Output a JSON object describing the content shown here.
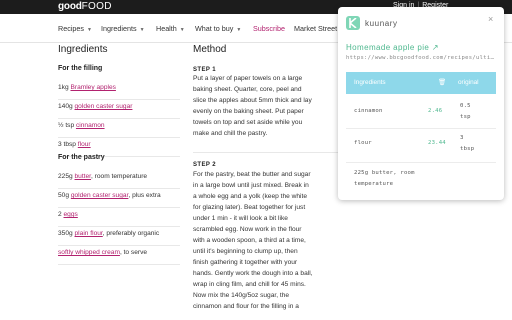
{
  "site": {
    "logo_bold": "good",
    "logo_light": "FOOD",
    "auth": {
      "sign_in": "Sign in",
      "separator": "|",
      "register": "Register"
    }
  },
  "nav": {
    "items": [
      {
        "label": "Recipes",
        "caret": "▼"
      },
      {
        "label": "Ingredients",
        "caret": "▼"
      },
      {
        "label": "Health",
        "caret": "▼"
      },
      {
        "label": "What to buy",
        "caret": "▼"
      },
      {
        "label": "Subscribe",
        "caret": ""
      },
      {
        "label": "Market Street",
        "caret": ""
      }
    ]
  },
  "ingredients": {
    "title": "Ingredients",
    "filling_heading": "For the filling",
    "filling": [
      {
        "qty": "1kg ",
        "link": "Bramley apples",
        "rest": ""
      },
      {
        "qty": "140g ",
        "link": "golden caster sugar",
        "rest": ""
      },
      {
        "qty": "½ tsp ",
        "link": "cinnamon",
        "rest": ""
      },
      {
        "qty": "3 tbsp ",
        "link": "flour",
        "rest": ""
      }
    ],
    "pastry_heading": "For the pastry",
    "pastry": [
      {
        "qty": "225g ",
        "link": "butter",
        "rest": ", room temperature"
      },
      {
        "qty": "50g ",
        "link": "golden caster sugar",
        "rest": ", plus extra"
      },
      {
        "qty": "2 ",
        "link": "eggs",
        "rest": ""
      },
      {
        "qty": "350g ",
        "link": "plain flour",
        "rest": ", preferably organic"
      },
      {
        "qty": "",
        "link": "softly whipped cream",
        "rest": ", to serve"
      }
    ]
  },
  "method": {
    "title": "Method",
    "step1_label": "STEP 1",
    "step1_lines": [
      "Put a layer of paper towels on a large",
      "baking sheet. Quarter, core, peel and",
      "slice the apples about 5mm thick and lay",
      "evenly on the baking sheet. Put paper",
      "towels on top and set aside while you",
      "make and chill the pastry."
    ],
    "step2_label": "STEP 2",
    "step2_lines": [
      "For the pastry, beat the butter and sugar",
      "in a large bowl until just mixed. Break in",
      "a whole egg and a yolk (keep the white",
      "for glazing later). Beat together for just",
      "under 1 min - it will look a bit like",
      "scrambled egg. Now work in the flour",
      "with a wooden spoon, a third at a time,",
      "until it's beginning to clump up, then",
      "finish gathering it together with your",
      "hands. Gently work the dough into a ball,",
      "wrap in cling film, and chill for 45 mins.",
      "Now mix the 140g/5oz sugar, the",
      "cinnamon and flour for the filling in a"
    ]
  },
  "popup": {
    "brand": "kuunary",
    "close": "×",
    "title": "Homemade apple pie ↗",
    "url": "https://www.bbcgoodfood.com/recipes/ulti…",
    "table": {
      "header_ingredient": "Ingredients",
      "header_icon": "🗑",
      "header_original": "original",
      "rows": [
        {
          "name": "cinnamon",
          "value": "2.46",
          "original_1": "0.5",
          "original_2": "tsp"
        },
        {
          "name": "flour",
          "value": "23.44",
          "original_1": "3",
          "original_2": "tbsp"
        },
        {
          "name_1": "225g butter, room",
          "name_2": "temperature"
        }
      ]
    },
    "colors": {
      "accent": "#4fb88f",
      "header": "#8ed8ea",
      "logo": "#7fd6b6"
    }
  },
  "colors": {
    "link": "#b2226f",
    "topbar": "#1c1c1c"
  }
}
